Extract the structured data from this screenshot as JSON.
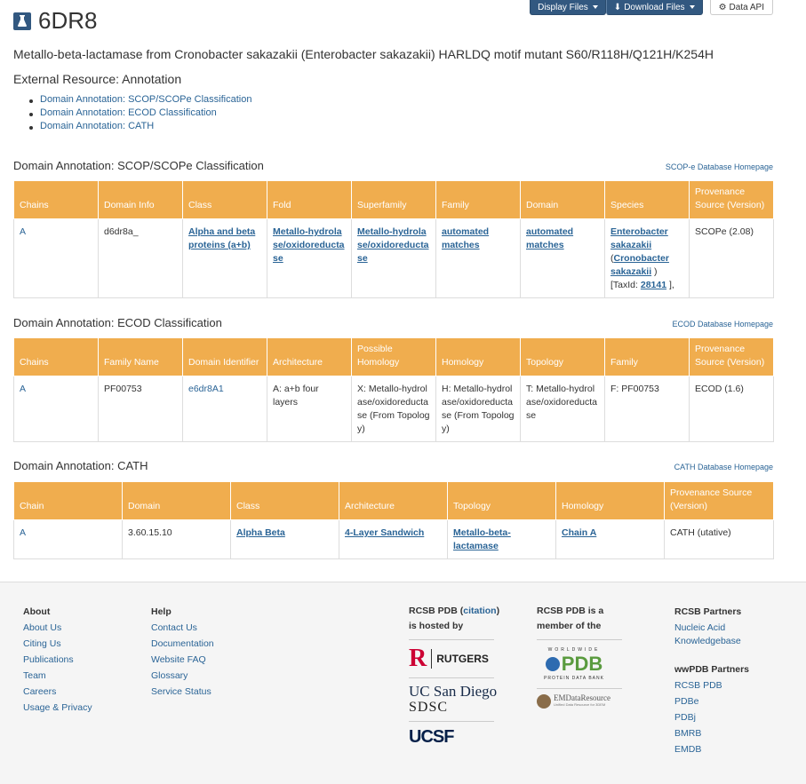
{
  "header": {
    "title": "6DR8",
    "buttons": {
      "display_files": "Display Files",
      "download_files": "Download Files",
      "data_api": "Data API"
    },
    "subtitle": "Metallo-beta-lactamase from Cronobacter sakazakii (Enterobacter sakazakii) HARLDQ motif mutant S60/R118H/Q121H/K254H",
    "external_resource": "External Resource: Annotation",
    "toc": [
      "Domain Annotation: SCOP/SCOPe Classification",
      "Domain Annotation: ECOD Classification",
      "Domain Annotation: CATH"
    ]
  },
  "scop": {
    "heading": "Domain Annotation: SCOP/SCOPe Classification",
    "homepage_link": "SCOP-e Database Homepage",
    "columns": [
      "Chains",
      "Domain Info",
      "Class",
      "Fold",
      "Superfamily",
      "Family",
      "Domain",
      "Species",
      "Provenance Source (Version)"
    ],
    "row": {
      "chain": "A",
      "domain_info": "d6dr8a_",
      "class": "Alpha and beta proteins (a+b)",
      "fold": "Metallo-hydrolase/oxidoreductase",
      "superfamily": "Metallo-hydrolase/oxidoreductase",
      "family": "automated matches",
      "domain": "automated matches",
      "species_main": "Enterobacter sakazakii",
      "species_paren_open": "(",
      "species_alt": "Cronobacter sakazakii",
      "species_paren_close": ")",
      "taxid_prefix": "[TaxId:",
      "taxid": "28141",
      "taxid_suffix": "],",
      "provenance": "SCOPe (2.08)"
    }
  },
  "ecod": {
    "heading": "Domain Annotation: ECOD Classification",
    "homepage_link": "ECOD Database Homepage",
    "columns": [
      "Chains",
      "Family Name",
      "Domain Identifier",
      "Architecture",
      "Possible Homology",
      "Homology",
      "Topology",
      "Family",
      "Provenance Source (Version)"
    ],
    "row": {
      "chain": "A",
      "family_name": "PF00753",
      "domain_identifier": "e6dr8A1",
      "architecture": "A: a+b four layers",
      "possible_homology": "X: Metallo-hydrolase/oxidoreductase (From Topology)",
      "homology": "H: Metallo-hydrolase/oxidoreductase (From Topology)",
      "topology": "T: Metallo-hydrolase/oxidoreductase",
      "family": "F: PF00753",
      "provenance": "ECOD (1.6)"
    }
  },
  "cath": {
    "heading": "Domain Annotation: CATH",
    "homepage_link": "CATH Database Homepage",
    "columns": [
      "Chain",
      "Domain",
      "Class",
      "Architecture",
      "Topology",
      "Homology",
      "Provenance Source (Version)"
    ],
    "row": {
      "chain": "A",
      "domain": "3.60.15.10",
      "class": "Alpha Beta",
      "architecture": "4-Layer Sandwich",
      "topology": "Metallo-beta-lactamase",
      "homology": "Chain A",
      "provenance": "CATH (utative)"
    }
  },
  "footer": {
    "about": {
      "heading": "About",
      "links": [
        "About Us",
        "Citing Us",
        "Publications",
        "Team",
        "Careers",
        "Usage & Privacy"
      ]
    },
    "help": {
      "heading": "Help",
      "links": [
        "Contact Us",
        "Documentation",
        "Website FAQ",
        "Glossary",
        "Service Status"
      ]
    },
    "hosted": {
      "line1_prefix": "RCSB PDB (",
      "citation": "citation",
      "line1_suffix": ")",
      "line2": "is hosted by",
      "rutgers": "RUTGERS",
      "ucsd": "UC San Diego",
      "sdsc": "SDSC",
      "ucsf": "UCSF"
    },
    "member": {
      "line1": "RCSB PDB is a",
      "line2": "member of the",
      "wwpdb_top": "WORLDWIDE",
      "wwpdb": "PDB",
      "wwpdb_bottom": "PROTEIN DATA BANK",
      "emdr": "EMDataResource",
      "emdr_sub": "Unified Data Resource for 3DEM"
    },
    "partners": {
      "heading": "RCSB Partners",
      "links": [
        "Nucleic Acid Knowledgebase"
      ],
      "ww_heading": "wwPDB Partners",
      "ww_links": [
        "RCSB PDB",
        "PDBe",
        "PDBj",
        "BMRB",
        "EMDB"
      ]
    }
  }
}
